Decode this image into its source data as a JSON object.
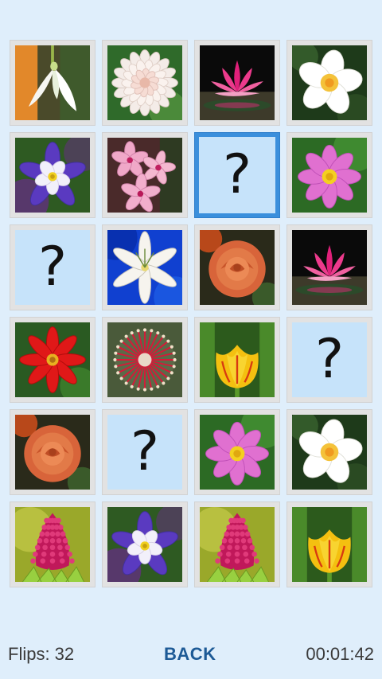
{
  "footer": {
    "flips_label": "Flips: 32",
    "back_label": "BACK",
    "timer": "00:01:42"
  },
  "hidden_symbol": "?",
  "cards": [
    {
      "state": "revealed",
      "flower": "snowdrop",
      "icon": "snowdrop-icon"
    },
    {
      "state": "revealed",
      "flower": "white-dahlia",
      "icon": "dahlia-icon"
    },
    {
      "state": "revealed",
      "flower": "pink-water-lily",
      "icon": "water-lily-icon"
    },
    {
      "state": "revealed",
      "flower": "white-plumeria",
      "icon": "plumeria-icon"
    },
    {
      "state": "revealed",
      "flower": "purple-columbine",
      "icon": "columbine-icon"
    },
    {
      "state": "revealed",
      "flower": "pink-orchid",
      "icon": "orchid-icon"
    },
    {
      "state": "hidden",
      "selected": true
    },
    {
      "state": "revealed",
      "flower": "pink-cosmos",
      "icon": "cosmos-icon"
    },
    {
      "state": "hidden"
    },
    {
      "state": "revealed",
      "flower": "white-lily",
      "icon": "lily-icon"
    },
    {
      "state": "revealed",
      "flower": "orange-rose",
      "icon": "rose-icon"
    },
    {
      "state": "revealed",
      "flower": "pink-water-lily",
      "icon": "water-lily-icon"
    },
    {
      "state": "revealed",
      "flower": "red-dahlia",
      "icon": "dahlia-icon"
    },
    {
      "state": "revealed",
      "flower": "red-spiky-flower",
      "icon": "spiky-flower-icon"
    },
    {
      "state": "revealed",
      "flower": "yellow-tulip",
      "icon": "tulip-icon"
    },
    {
      "state": "hidden"
    },
    {
      "state": "revealed",
      "flower": "orange-rose",
      "icon": "rose-icon"
    },
    {
      "state": "hidden"
    },
    {
      "state": "revealed",
      "flower": "pink-cosmos",
      "icon": "cosmos-icon"
    },
    {
      "state": "revealed",
      "flower": "white-plumeria",
      "icon": "plumeria-icon"
    },
    {
      "state": "revealed",
      "flower": "magenta-cone-flower",
      "icon": "cone-flower-icon"
    },
    {
      "state": "revealed",
      "flower": "purple-columbine",
      "icon": "columbine-icon"
    },
    {
      "state": "revealed",
      "flower": "magenta-cone-flower",
      "icon": "cone-flower-icon"
    },
    {
      "state": "revealed",
      "flower": "yellow-tulip",
      "icon": "tulip-icon"
    }
  ],
  "colors": {
    "background": "#dfeefb",
    "hidden_card": "#c6e3fa",
    "selected_border": "#3a8fdc",
    "back_button": "#1d5a96"
  }
}
